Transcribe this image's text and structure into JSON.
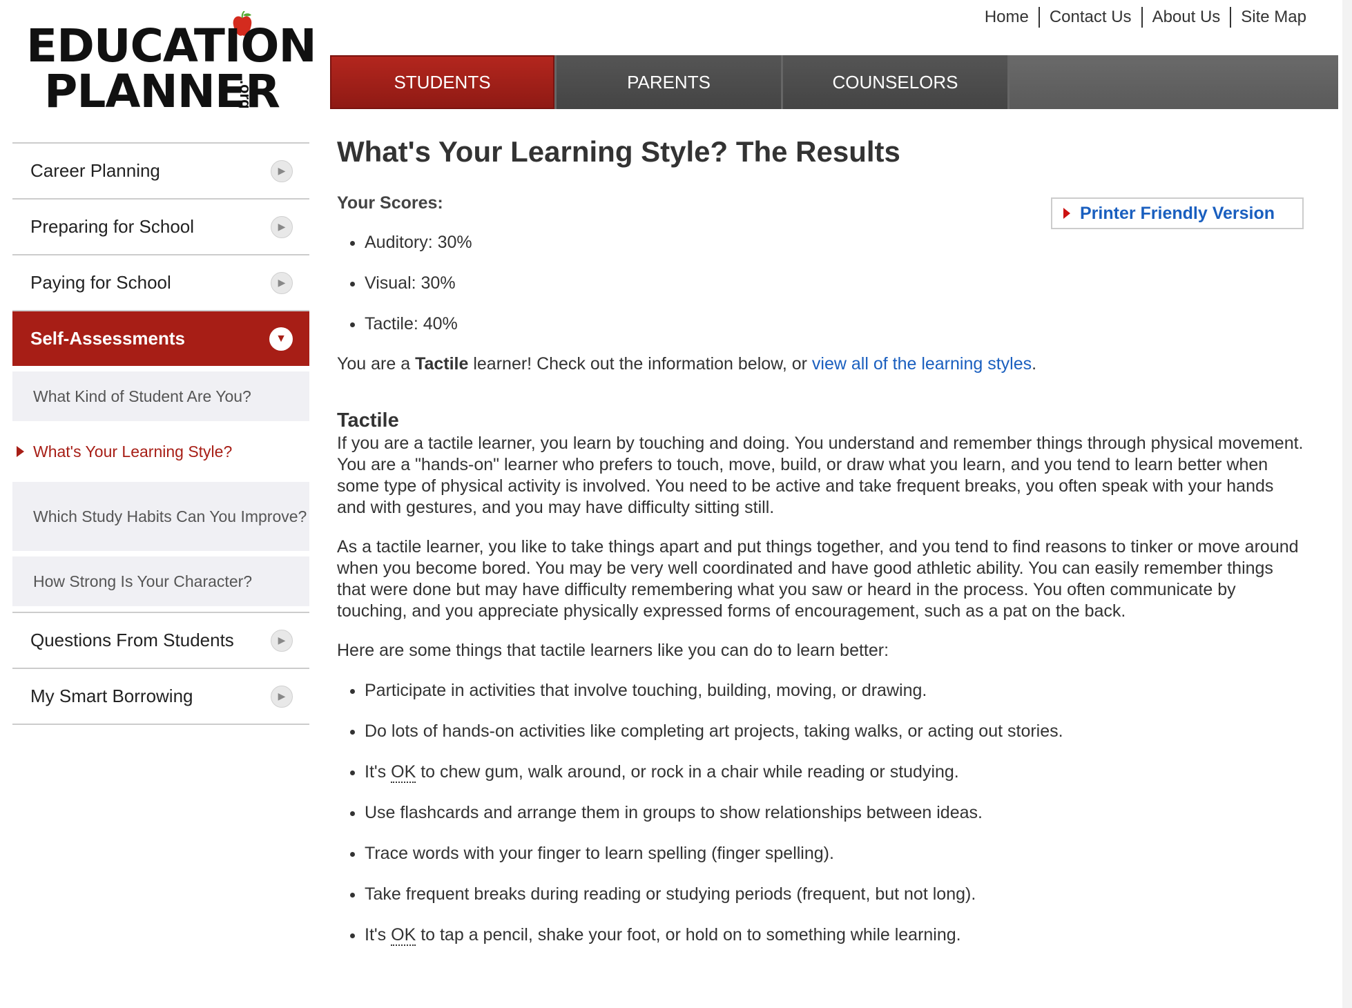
{
  "logo": {
    "line1": "EDUCATION",
    "line2": "PLANNER",
    "suffix": ".org"
  },
  "utility_nav": [
    "Home",
    "Contact Us",
    "About Us",
    "Site Map"
  ],
  "tabs": [
    "STUDENTS",
    "PARENTS",
    "COUNSELORS"
  ],
  "sidebar": {
    "items": [
      {
        "label": "Career Planning"
      },
      {
        "label": "Preparing for School"
      },
      {
        "label": "Paying for School"
      },
      {
        "label": "Self-Assessments"
      },
      {
        "label": "Questions From Students"
      },
      {
        "label": "My Smart Borrowing"
      }
    ],
    "sub_items": [
      {
        "label": "What Kind of Student Are You?"
      },
      {
        "label": "What's Your Learning Style?"
      },
      {
        "label": "Which Study Habits Can You Improve?"
      },
      {
        "label": "How Strong Is Your Character?"
      }
    ]
  },
  "main": {
    "title": "What's Your Learning Style? The Results",
    "scores_label": "Your Scores:",
    "printer_label": "Printer Friendly Version",
    "scores": [
      "Auditory: 30%",
      "Visual: 30%",
      "Tactile: 40%"
    ],
    "result": {
      "prefix": "You are a ",
      "style": "Tactile",
      "middle": " learner! Check out the information below, or ",
      "link": "view all of the learning styles",
      "suffix": "."
    },
    "section_title": "Tactile",
    "para1": "If you are a tactile learner, you learn by touching and doing. You understand and remember things through physical movement. You are a \"hands-on\" learner who prefers to touch, move, build, or draw what you learn, and you tend to learn better when some type of physical activity is involved. You need to be active and take frequent breaks, you often speak with your hands and with gestures, and you may have difficulty sitting still.",
    "para2": "As a tactile learner, you like to take things apart and put things together, and you tend to find reasons to tinker or move around when you become bored. You may be very well coordinated and have good athletic ability. You can easily remember things that were done but may have difficulty remembering what you saw or heard in the process. You often communicate by touching, and you appreciate physically expressed forms of encouragement, such as a pat on the back.",
    "para3": "Here are some things that tactile learners like you can do to learn better:",
    "tips": [
      {
        "pre": "Participate in activities that involve touching, building, moving, or drawing.",
        "ok": "",
        "post": ""
      },
      {
        "pre": "Do lots of hands-on activities like completing art projects, taking walks, or acting out stories.",
        "ok": "",
        "post": ""
      },
      {
        "pre": "It's ",
        "ok": "OK",
        "post": " to chew gum, walk around, or rock in a chair while reading or studying."
      },
      {
        "pre": "Use flashcards and arrange them in groups to show relationships between ideas.",
        "ok": "",
        "post": ""
      },
      {
        "pre": "Trace words with your finger to learn spelling (finger spelling).",
        "ok": "",
        "post": ""
      },
      {
        "pre": "Take frequent breaks during reading or studying periods (frequent, but not long).",
        "ok": "",
        "post": ""
      },
      {
        "pre": "It's ",
        "ok": "OK",
        "post": " to tap a pencil, shake your foot, or hold on to something while learning."
      }
    ]
  }
}
